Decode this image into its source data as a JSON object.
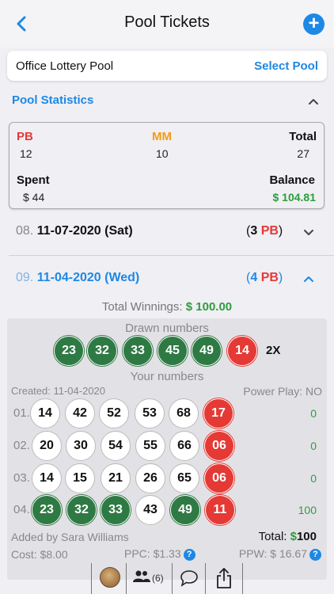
{
  "header": {
    "title": "Pool Tickets",
    "back_icon": "chevron-left-icon",
    "add_icon": "plus-icon",
    "accent": "#1e88e5"
  },
  "pool": {
    "name": "Office Lottery Pool",
    "select_label": "Select Pool"
  },
  "stats": {
    "title": "Pool Statistics",
    "pb_label": "PB",
    "pb_value": "12",
    "mm_label": "MM",
    "mm_value": "10",
    "total_label": "Total",
    "total_value": "27",
    "spent_label": "Spent",
    "spent_value": "$ 44",
    "balance_label": "Balance",
    "balance_value": "$ 104.81"
  },
  "draws": [
    {
      "index": "08.",
      "date": "11-07-2020 (Sat)",
      "count_open": "(",
      "count": "3",
      "type": "PB",
      "count_close": ")"
    },
    {
      "index": "09.",
      "date": "11-04-2020 (Wed)",
      "count_open": "(",
      "count": "4",
      "type": "PB",
      "count_close": ")"
    }
  ],
  "winnings": {
    "label": "Total Winnings:",
    "value": "$ 100.00"
  },
  "drawn": {
    "label": "Drawn numbers",
    "balls": [
      "23",
      "32",
      "33",
      "45",
      "49",
      "14"
    ],
    "multiplier": "2X"
  },
  "your_numbers": {
    "label": "Your numbers",
    "created": "Created: 11-04-2020",
    "power_play": "Power Play: NO",
    "rows": [
      {
        "index": "01.",
        "balls": [
          "14",
          "42",
          "52",
          "53",
          "68",
          "17"
        ],
        "win": "0"
      },
      {
        "index": "02.",
        "balls": [
          "20",
          "30",
          "54",
          "55",
          "66",
          "06"
        ],
        "win": "0"
      },
      {
        "index": "03.",
        "balls": [
          "14",
          "15",
          "21",
          "26",
          "65",
          "06"
        ],
        "win": "0"
      },
      {
        "index": "04.",
        "balls": [
          "23",
          "32",
          "33",
          "43",
          "49",
          "11"
        ],
        "win": "100"
      }
    ]
  },
  "footer": {
    "added_by": "Added by Sara Williams",
    "total_label": "Total:",
    "total_currency": "$",
    "total_value": "100",
    "cost": "Cost: $8.00",
    "ppc": "PPC: $1.33",
    "ppw": "PPW: $ 16.67",
    "help_glyph": "?"
  },
  "toolbar": {
    "members_count": "(6)",
    "icons": [
      "avatar",
      "people-icon",
      "chat-icon",
      "share-icon"
    ]
  },
  "colors": {
    "pb_red": "#e53935",
    "mm_orange": "#f39c12",
    "win_green": "#2e9d3c",
    "ball_green": "#2f7a44"
  }
}
